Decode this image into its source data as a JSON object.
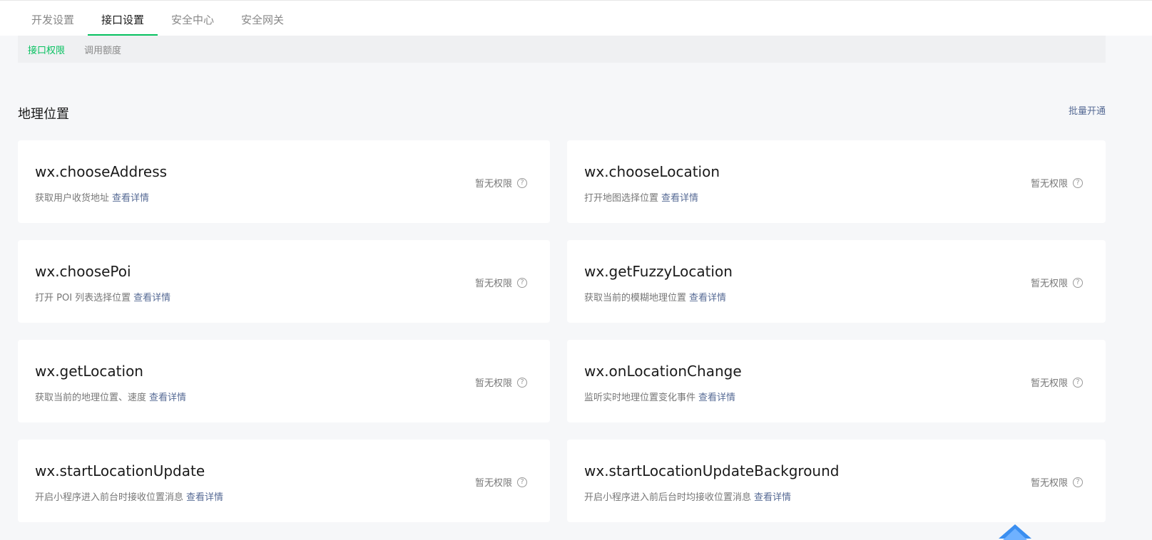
{
  "tabs": [
    {
      "label": "开发设置",
      "active": false
    },
    {
      "label": "接口设置",
      "active": true
    },
    {
      "label": "安全中心",
      "active": false
    },
    {
      "label": "安全网关",
      "active": false
    }
  ],
  "subtabs": [
    {
      "label": "接口权限",
      "active": true
    },
    {
      "label": "调用额度",
      "active": false
    }
  ],
  "section": {
    "title": "地理位置",
    "batch_label": "批量开通"
  },
  "common": {
    "permission_status": "暂无权限",
    "detail_label": "查看详情",
    "help_glyph": "?"
  },
  "apis": [
    {
      "name": "wx.chooseAddress",
      "desc": "获取用户收货地址"
    },
    {
      "name": "wx.chooseLocation",
      "desc": "打开地图选择位置"
    },
    {
      "name": "wx.choosePoi",
      "desc": "打开 POI 列表选择位置"
    },
    {
      "name": "wx.getFuzzyLocation",
      "desc": "获取当前的模糊地理位置"
    },
    {
      "name": "wx.getLocation",
      "desc": "获取当前的地理位置、速度"
    },
    {
      "name": "wx.onLocationChange",
      "desc": "监听实时地理位置变化事件"
    },
    {
      "name": "wx.startLocationUpdate",
      "desc": "开启小程序进入前台时接收位置消息"
    },
    {
      "name": "wx.startLocationUpdateBackground",
      "desc": "开启小程序进入前后台时均接收位置消息"
    }
  ],
  "colors": {
    "accent": "#07c160",
    "link": "#576b95",
    "float_widget": "#3a8ef0"
  }
}
